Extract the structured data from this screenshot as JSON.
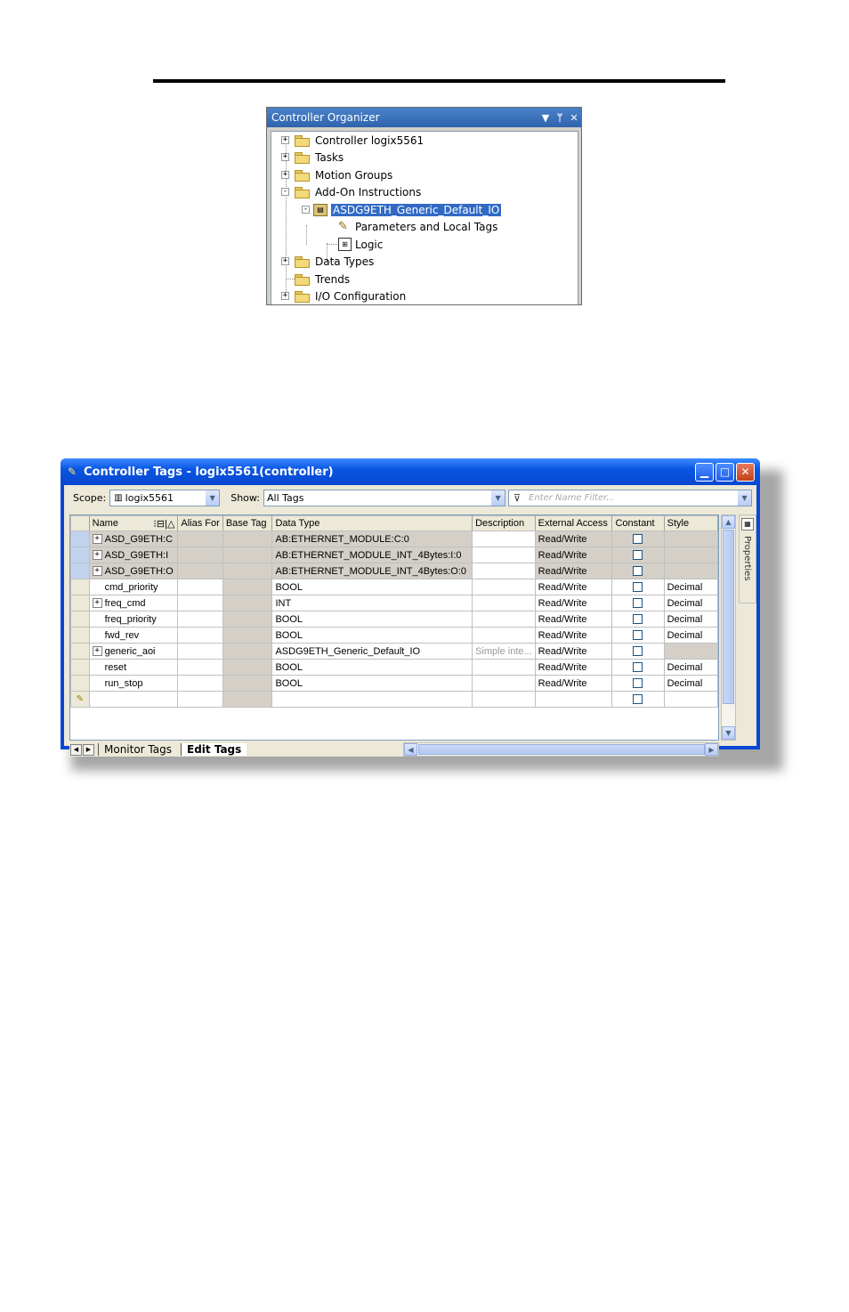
{
  "organizer": {
    "title": "Controller Organizer",
    "title_icons": [
      "dropdown-arrow-icon",
      "pin-icon",
      "close-icon"
    ],
    "items": [
      {
        "label": "Controller logix5561",
        "expander": "+"
      },
      {
        "label": "Tasks",
        "expander": "+"
      },
      {
        "label": "Motion Groups",
        "expander": "+"
      },
      {
        "label": "Add-On Instructions",
        "expander": "-"
      },
      {
        "label": "ASDG9ETH_Generic_Default_IO",
        "expander": "-"
      },
      {
        "label": "Parameters and Local Tags"
      },
      {
        "label": "Logic"
      },
      {
        "label": "Data Types",
        "expander": "+"
      },
      {
        "label": "Trends"
      },
      {
        "label": "I/O Configuration",
        "expander": "+"
      }
    ]
  },
  "tags_window": {
    "title": "Controller Tags - logix5561(controller)",
    "scope_label": "Scope:",
    "scope_value": "logix5561",
    "show_label": "Show:",
    "show_value": "All Tags",
    "filter_placeholder": "Enter Name Filter...",
    "columns": [
      "Name",
      "Alias For",
      "Base Tag",
      "Data Type",
      "Description",
      "External Access",
      "Constant",
      "Style"
    ],
    "sort_indicator": "△",
    "rows": [
      {
        "expander": "+",
        "name": "ASD_G9ETH:C",
        "alias": "",
        "base": "",
        "type": "AB:ETHERNET_MODULE:C:0",
        "desc": "",
        "access": "Read/Write",
        "style": "",
        "gray": true
      },
      {
        "expander": "+",
        "name": "ASD_G9ETH:I",
        "alias": "",
        "base": "",
        "type": "AB:ETHERNET_MODULE_INT_4Bytes:I:0",
        "desc": "",
        "access": "Read/Write",
        "style": "",
        "gray": true
      },
      {
        "expander": "+",
        "name": "ASD_G9ETH:O",
        "alias": "",
        "base": "",
        "type": "AB:ETHERNET_MODULE_INT_4Bytes:O:0",
        "desc": "",
        "access": "Read/Write",
        "style": "",
        "gray": true
      },
      {
        "expander": "",
        "name": "cmd_priority",
        "alias": "",
        "base": "",
        "type": "BOOL",
        "desc": "",
        "access": "Read/Write",
        "style": "Decimal"
      },
      {
        "expander": "+",
        "name": "freq_cmd",
        "alias": "",
        "base": "",
        "type": "INT",
        "desc": "",
        "access": "Read/Write",
        "style": "Decimal"
      },
      {
        "expander": "",
        "name": "freq_priority",
        "alias": "",
        "base": "",
        "type": "BOOL",
        "desc": "",
        "access": "Read/Write",
        "style": "Decimal"
      },
      {
        "expander": "",
        "name": "fwd_rev",
        "alias": "",
        "base": "",
        "type": "BOOL",
        "desc": "",
        "access": "Read/Write",
        "style": "Decimal"
      },
      {
        "expander": "+",
        "name": "generic_aoi",
        "alias": "",
        "base": "",
        "type": "ASDG9ETH_Generic_Default_IO",
        "desc": "Simple inte...",
        "access": "Read/Write",
        "style": ""
      },
      {
        "expander": "",
        "name": "reset",
        "alias": "",
        "base": "",
        "type": "BOOL",
        "desc": "",
        "access": "Read/Write",
        "style": "Decimal"
      },
      {
        "expander": "",
        "name": "run_stop",
        "alias": "",
        "base": "",
        "type": "BOOL",
        "desc": "",
        "access": "Read/Write",
        "style": "Decimal"
      }
    ],
    "side_panel_label": "Properties",
    "tabs": [
      "Monitor Tags",
      "Edit Tags"
    ],
    "active_tab": "Edit Tags"
  }
}
